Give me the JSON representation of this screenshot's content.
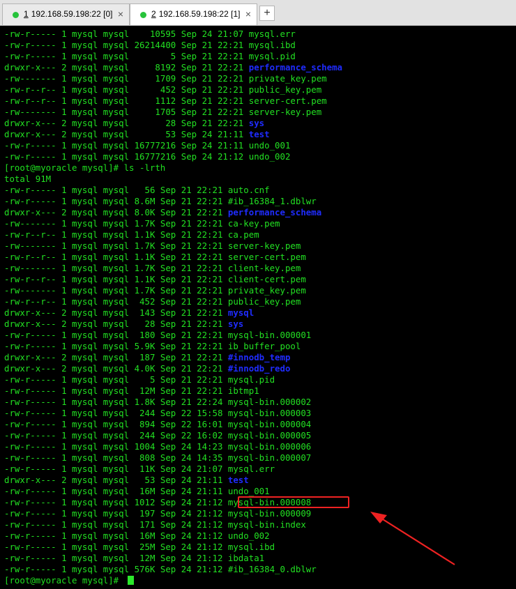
{
  "tabs": [
    {
      "number": "1",
      "title": "192.168.59.198:22 [0]",
      "status_color": "#27c33b",
      "active": false
    },
    {
      "number": "2",
      "title": "192.168.59.198:22 [1]",
      "status_color": "#27c33b",
      "active": true
    }
  ],
  "close_glyph": "×",
  "add_tab_glyph": "+",
  "terminal": {
    "lines": [
      {
        "perm": "-rw-r-----",
        "n": "1",
        "owner": "mysql",
        "group": "mysql",
        "size": "   10595",
        "date": "Sep 24 21:07",
        "name": "mysql.err",
        "dir": false
      },
      {
        "perm": "-rw-r-----",
        "n": "1",
        "owner": "mysql",
        "group": "mysql",
        "size": "26214400",
        "date": "Sep 21 22:21",
        "name": "mysql.ibd",
        "dir": false
      },
      {
        "perm": "-rw-r-----",
        "n": "1",
        "owner": "mysql",
        "group": "mysql",
        "size": "       5",
        "date": "Sep 21 22:21",
        "name": "mysql.pid",
        "dir": false
      },
      {
        "perm": "drwxr-x---",
        "n": "2",
        "owner": "mysql",
        "group": "mysql",
        "size": "    8192",
        "date": "Sep 21 22:21",
        "name": "performance_schema",
        "dir": true
      },
      {
        "perm": "-rw-------",
        "n": "1",
        "owner": "mysql",
        "group": "mysql",
        "size": "    1709",
        "date": "Sep 21 22:21",
        "name": "private_key.pem",
        "dir": false
      },
      {
        "perm": "-rw-r--r--",
        "n": "1",
        "owner": "mysql",
        "group": "mysql",
        "size": "     452",
        "date": "Sep 21 22:21",
        "name": "public_key.pem",
        "dir": false
      },
      {
        "perm": "-rw-r--r--",
        "n": "1",
        "owner": "mysql",
        "group": "mysql",
        "size": "    1112",
        "date": "Sep 21 22:21",
        "name": "server-cert.pem",
        "dir": false
      },
      {
        "perm": "-rw-------",
        "n": "1",
        "owner": "mysql",
        "group": "mysql",
        "size": "    1705",
        "date": "Sep 21 22:21",
        "name": "server-key.pem",
        "dir": false
      },
      {
        "perm": "drwxr-x---",
        "n": "2",
        "owner": "mysql",
        "group": "mysql",
        "size": "      28",
        "date": "Sep 21 22:21",
        "name": "sys",
        "dir": true
      },
      {
        "perm": "drwxr-x---",
        "n": "2",
        "owner": "mysql",
        "group": "mysql",
        "size": "      53",
        "date": "Sep 24 21:11",
        "name": "test",
        "dir": true
      },
      {
        "perm": "-rw-r-----",
        "n": "1",
        "owner": "mysql",
        "group": "mysql",
        "size": "16777216",
        "date": "Sep 24 21:11",
        "name": "undo_001",
        "dir": false
      },
      {
        "perm": "-rw-r-----",
        "n": "1",
        "owner": "mysql",
        "group": "mysql",
        "size": "16777216",
        "date": "Sep 24 21:12",
        "name": "undo_002",
        "dir": false
      },
      {
        "prompt": "[root@myoracle mysql]# ls -lrth"
      },
      {
        "text": "total 91M"
      },
      {
        "perm": "-rw-r-----",
        "n": "1",
        "owner": "mysql",
        "group": "mysql",
        "size": "  56",
        "date": "Sep 21 22:21",
        "name": "auto.cnf",
        "dir": false
      },
      {
        "perm": "-rw-r-----",
        "n": "1",
        "owner": "mysql",
        "group": "mysql",
        "size": "8.6M",
        "date": "Sep 21 22:21",
        "name": "#ib_16384_1.dblwr",
        "dir": false
      },
      {
        "perm": "drwxr-x---",
        "n": "2",
        "owner": "mysql",
        "group": "mysql",
        "size": "8.0K",
        "date": "Sep 21 22:21",
        "name": "performance_schema",
        "dir": true
      },
      {
        "perm": "-rw-------",
        "n": "1",
        "owner": "mysql",
        "group": "mysql",
        "size": "1.7K",
        "date": "Sep 21 22:21",
        "name": "ca-key.pem",
        "dir": false
      },
      {
        "perm": "-rw-r--r--",
        "n": "1",
        "owner": "mysql",
        "group": "mysql",
        "size": "1.1K",
        "date": "Sep 21 22:21",
        "name": "ca.pem",
        "dir": false
      },
      {
        "perm": "-rw-------",
        "n": "1",
        "owner": "mysql",
        "group": "mysql",
        "size": "1.7K",
        "date": "Sep 21 22:21",
        "name": "server-key.pem",
        "dir": false
      },
      {
        "perm": "-rw-r--r--",
        "n": "1",
        "owner": "mysql",
        "group": "mysql",
        "size": "1.1K",
        "date": "Sep 21 22:21",
        "name": "server-cert.pem",
        "dir": false
      },
      {
        "perm": "-rw-------",
        "n": "1",
        "owner": "mysql",
        "group": "mysql",
        "size": "1.7K",
        "date": "Sep 21 22:21",
        "name": "client-key.pem",
        "dir": false
      },
      {
        "perm": "-rw-r--r--",
        "n": "1",
        "owner": "mysql",
        "group": "mysql",
        "size": "1.1K",
        "date": "Sep 21 22:21",
        "name": "client-cert.pem",
        "dir": false
      },
      {
        "perm": "-rw-------",
        "n": "1",
        "owner": "mysql",
        "group": "mysql",
        "size": "1.7K",
        "date": "Sep 21 22:21",
        "name": "private_key.pem",
        "dir": false
      },
      {
        "perm": "-rw-r--r--",
        "n": "1",
        "owner": "mysql",
        "group": "mysql",
        "size": " 452",
        "date": "Sep 21 22:21",
        "name": "public_key.pem",
        "dir": false
      },
      {
        "perm": "drwxr-x---",
        "n": "2",
        "owner": "mysql",
        "group": "mysql",
        "size": " 143",
        "date": "Sep 21 22:21",
        "name": "mysql",
        "dir": true
      },
      {
        "perm": "drwxr-x---",
        "n": "2",
        "owner": "mysql",
        "group": "mysql",
        "size": "  28",
        "date": "Sep 21 22:21",
        "name": "sys",
        "dir": true
      },
      {
        "perm": "-rw-r-----",
        "n": "1",
        "owner": "mysql",
        "group": "mysql",
        "size": " 180",
        "date": "Sep 21 22:21",
        "name": "mysql-bin.000001",
        "dir": false
      },
      {
        "perm": "-rw-r-----",
        "n": "1",
        "owner": "mysql",
        "group": "mysql",
        "size": "5.9K",
        "date": "Sep 21 22:21",
        "name": "ib_buffer_pool",
        "dir": false
      },
      {
        "perm": "drwxr-x---",
        "n": "2",
        "owner": "mysql",
        "group": "mysql",
        "size": " 187",
        "date": "Sep 21 22:21",
        "name": "#innodb_temp",
        "dir": true
      },
      {
        "perm": "drwxr-x---",
        "n": "2",
        "owner": "mysql",
        "group": "mysql",
        "size": "4.0K",
        "date": "Sep 21 22:21",
        "name": "#innodb_redo",
        "dir": true
      },
      {
        "perm": "-rw-r-----",
        "n": "1",
        "owner": "mysql",
        "group": "mysql",
        "size": "   5",
        "date": "Sep 21 22:21",
        "name": "mysql.pid",
        "dir": false
      },
      {
        "perm": "-rw-r-----",
        "n": "1",
        "owner": "mysql",
        "group": "mysql",
        "size": " 12M",
        "date": "Sep 21 22:21",
        "name": "ibtmp1",
        "dir": false
      },
      {
        "perm": "-rw-r-----",
        "n": "1",
        "owner": "mysql",
        "group": "mysql",
        "size": "1.8K",
        "date": "Sep 21 22:24",
        "name": "mysql-bin.000002",
        "dir": false
      },
      {
        "perm": "-rw-r-----",
        "n": "1",
        "owner": "mysql",
        "group": "mysql",
        "size": " 244",
        "date": "Sep 22 15:58",
        "name": "mysql-bin.000003",
        "dir": false
      },
      {
        "perm": "-rw-r-----",
        "n": "1",
        "owner": "mysql",
        "group": "mysql",
        "size": " 894",
        "date": "Sep 22 16:01",
        "name": "mysql-bin.000004",
        "dir": false
      },
      {
        "perm": "-rw-r-----",
        "n": "1",
        "owner": "mysql",
        "group": "mysql",
        "size": " 244",
        "date": "Sep 22 16:02",
        "name": "mysql-bin.000005",
        "dir": false
      },
      {
        "perm": "-rw-r-----",
        "n": "1",
        "owner": "mysql",
        "group": "mysql",
        "size": "1004",
        "date": "Sep 24 14:23",
        "name": "mysql-bin.000006",
        "dir": false
      },
      {
        "perm": "-rw-r-----",
        "n": "1",
        "owner": "mysql",
        "group": "mysql",
        "size": " 808",
        "date": "Sep 24 14:35",
        "name": "mysql-bin.000007",
        "dir": false
      },
      {
        "perm": "-rw-r-----",
        "n": "1",
        "owner": "mysql",
        "group": "mysql",
        "size": " 11K",
        "date": "Sep 24 21:07",
        "name": "mysql.err",
        "dir": false
      },
      {
        "perm": "drwxr-x---",
        "n": "2",
        "owner": "mysql",
        "group": "mysql",
        "size": "  53",
        "date": "Sep 24 21:11",
        "name": "test",
        "dir": true
      },
      {
        "perm": "-rw-r-----",
        "n": "1",
        "owner": "mysql",
        "group": "mysql",
        "size": " 16M",
        "date": "Sep 24 21:11",
        "name": "undo_001",
        "dir": false
      },
      {
        "perm": "-rw-r-----",
        "n": "1",
        "owner": "mysql",
        "group": "mysql",
        "size": "1012",
        "date": "Sep 24 21:12",
        "name": "mysql-bin.000008",
        "dir": false,
        "highlighted": true
      },
      {
        "perm": "-rw-r-----",
        "n": "1",
        "owner": "mysql",
        "group": "mysql",
        "size": " 197",
        "date": "Sep 24 21:12",
        "name": "mysql-bin.000009",
        "dir": false
      },
      {
        "perm": "-rw-r-----",
        "n": "1",
        "owner": "mysql",
        "group": "mysql",
        "size": " 171",
        "date": "Sep 24 21:12",
        "name": "mysql-bin.index",
        "dir": false
      },
      {
        "perm": "-rw-r-----",
        "n": "1",
        "owner": "mysql",
        "group": "mysql",
        "size": " 16M",
        "date": "Sep 24 21:12",
        "name": "undo_002",
        "dir": false
      },
      {
        "perm": "-rw-r-----",
        "n": "1",
        "owner": "mysql",
        "group": "mysql",
        "size": " 25M",
        "date": "Sep 24 21:12",
        "name": "mysql.ibd",
        "dir": false
      },
      {
        "perm": "-rw-r-----",
        "n": "1",
        "owner": "mysql",
        "group": "mysql",
        "size": " 12M",
        "date": "Sep 24 21:12",
        "name": "ibdata1",
        "dir": false
      },
      {
        "perm": "-rw-r-----",
        "n": "1",
        "owner": "mysql",
        "group": "mysql",
        "size": "576K",
        "date": "Sep 24 21:12",
        "name": "#ib_16384_0.dblwr",
        "dir": false
      },
      {
        "prompt": "[root@myoracle mysql]# ",
        "cursor": true
      }
    ]
  },
  "colors": {
    "background": "#000000",
    "text": "#22e022",
    "directory": "#1f2cff",
    "annotation": "#ee2222"
  }
}
